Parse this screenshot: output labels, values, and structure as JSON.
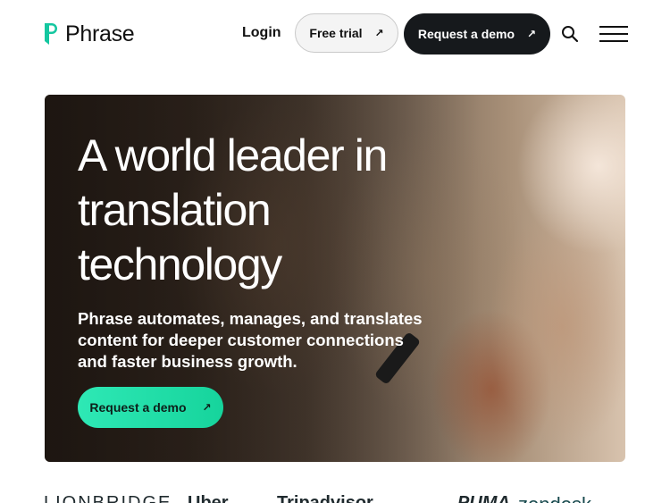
{
  "header": {
    "logo_text": "Phrase",
    "login_label": "Login",
    "free_trial_label": "Free trial",
    "request_demo_label": "Request a demo",
    "arrow_glyph": "↗"
  },
  "hero": {
    "title": "A world leader in translation technology",
    "subtitle": "Phrase automates, manages, and translates content for deeper customer connections and faster business growth.",
    "cta_label": "Request a demo"
  },
  "logos": [
    {
      "name": "LIONBRIDGE"
    },
    {
      "name": "Uber"
    },
    {
      "name": "Tripadvisor"
    },
    {
      "name": "PUMA"
    },
    {
      "name": "zendesk"
    }
  ],
  "colors": {
    "accent": "#1fdca8",
    "dark_button": "#16191c",
    "logo_mark": "#14c7a0"
  }
}
